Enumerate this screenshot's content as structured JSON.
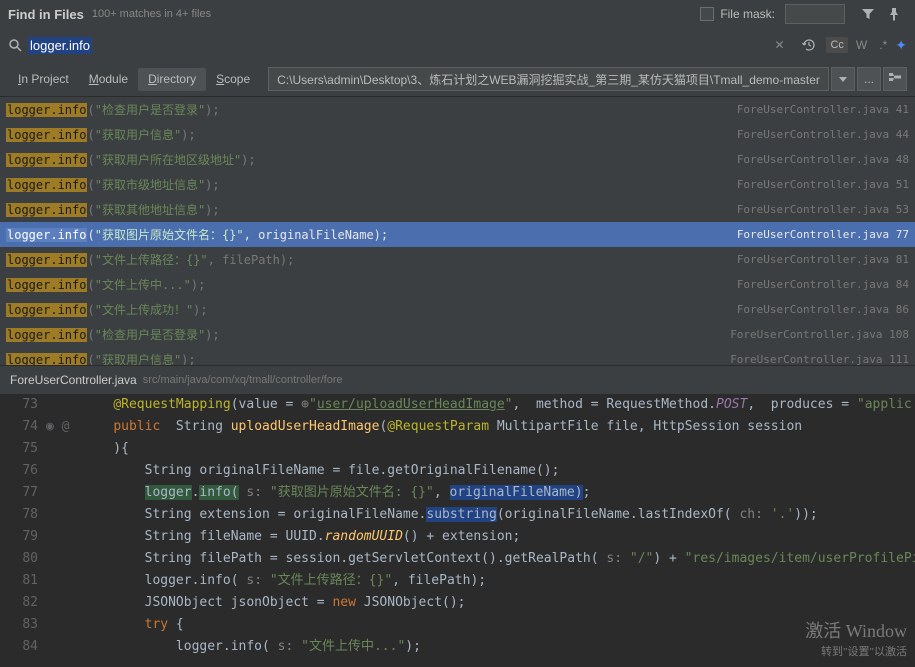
{
  "header": {
    "title": "Find in Files",
    "subtitle": "100+ matches in 4+ files",
    "fileMaskLabel": "File mask:"
  },
  "search": {
    "query": "logger.info"
  },
  "toolbar": {
    "cc": "Cc",
    "w": "W",
    "star": "✦"
  },
  "scope": {
    "tabs": [
      "In Project",
      "Module",
      "Directory",
      "Scope"
    ],
    "active": 2,
    "path": "C:\\Users\\admin\\Desktop\\3、炼石计划之WEB漏洞挖掘实战_第三期_某仿天猫项目\\Tmall_demo-master"
  },
  "results": [
    {
      "hl": "logger.info",
      "before": "(",
      "str": "\"检查用户是否登录\"",
      "after": ");",
      "file": "ForeUserController.java",
      "line": "41"
    },
    {
      "hl": "logger.info",
      "before": "(",
      "str": "\"获取用户信息\"",
      "after": ");",
      "file": "ForeUserController.java",
      "line": "44"
    },
    {
      "hl": "logger.info",
      "before": "(",
      "str": "\"获取用户所在地区级地址\"",
      "after": ");",
      "file": "ForeUserController.java",
      "line": "48"
    },
    {
      "hl": "logger.info",
      "before": "(",
      "str": "\"获取市级地址信息\"",
      "after": ");",
      "file": "ForeUserController.java",
      "line": "51"
    },
    {
      "hl": "logger.info",
      "before": "(",
      "str": "\"获取其他地址信息\"",
      "after": ");",
      "file": "ForeUserController.java",
      "line": "53"
    },
    {
      "hl": "logger.info",
      "before": "(",
      "str": "\"获取图片原始文件名：{}\"",
      "after": ", originalFileName);",
      "file": "ForeUserController.java",
      "line": "77",
      "selected": true
    },
    {
      "hl": "logger.info",
      "before": "(",
      "str": "\"文件上传路径：{}\"",
      "after": ", filePath);",
      "file": "ForeUserController.java",
      "line": "81"
    },
    {
      "hl": "logger.info",
      "before": "(",
      "str": "\"文件上传中...\"",
      "after": ");",
      "file": "ForeUserController.java",
      "line": "84"
    },
    {
      "hl": "logger.info",
      "before": "(",
      "str": "\"文件上传成功！\"",
      "after": ");",
      "file": "ForeUserController.java",
      "line": "86"
    },
    {
      "hl": "logger.info",
      "before": "(",
      "str": "\"检查用户是否登录\"",
      "after": ");",
      "file": "ForeUserController.java",
      "line": "108"
    },
    {
      "hl": "logger.info",
      "before": "(",
      "str": "\"获取用户信息\"",
      "after": ");",
      "file": "ForeUserController.java",
      "line": "111"
    }
  ],
  "preview": {
    "file": "ForeUserController.java",
    "path": "src/main/java/com/xq/tmall/controller/fore"
  },
  "code": [
    {
      "n": "73",
      "html": "    <span class='c-ann'>@RequestMapping</span>(value = <span style='color:#808080'>⊕</span><span class='c-str'>\"<span class='c-u'>user/uploadUserHeadImage</span>\"</span>,  method = RequestMethod.<span style='color:#9876aa;font-style:italic'>POST</span>,  produces = <span class='c-str'>\"applic</span>"
    },
    {
      "n": "74",
      "icons": "◉ @",
      "html": "    <span class='c-kw'>public</span>  String <span class='c-fn2'>uploadUserHeadImage</span>(<span class='c-ann'>@RequestParam</span> MultipartFile file, HttpSession session"
    },
    {
      "n": "75",
      "html": "    ){"
    },
    {
      "n": "76",
      "html": "        String originalFileName = file.getOriginalFilename();"
    },
    {
      "n": "77",
      "html": "        <span class='c-hl'>logger</span>.<span class='c-hl'>info(</span> <span style='color:#808080'>s:</span> <span class='c-str'>\"获取图片原始文件名: {}\"</span>, <span class='c-sel'>originalFileName)</span>;"
    },
    {
      "n": "78",
      "html": "        String extension = originalFileName.<span class='c-sel'>substring</span>(originalFileName.lastIndexOf( <span style='color:#808080'>ch:</span> <span class='c-str'>'.'</span>));"
    },
    {
      "n": "79",
      "html": "        String fileName = UUID.<span class='c-fn'>randomUUID</span>() + extension;"
    },
    {
      "n": "80",
      "html": "        String filePath = session.getServletContext().getRealPath( <span style='color:#808080'>s:</span> <span class='c-str'>\"/\"</span>) + <span class='c-str'>\"res/images/item/userProfilePi</span>"
    },
    {
      "n": "81",
      "html": "        logger.info( <span style='color:#808080'>s:</span> <span class='c-str'>\"文件上传路径：{}\"</span>, filePath);"
    },
    {
      "n": "82",
      "html": "        JSONObject jsonObject = <span class='c-kw'>new</span> JSONObject();"
    },
    {
      "n": "83",
      "html": "        <span class='c-kw'>try</span> {"
    },
    {
      "n": "84",
      "html": "            logger.info( <span style='color:#808080'>s:</span> <span class='c-str'>\"文件上传中...\"</span>);"
    }
  ],
  "watermark": {
    "line1": "激活 Window",
    "line2": "转到\"设置\"以激活"
  }
}
